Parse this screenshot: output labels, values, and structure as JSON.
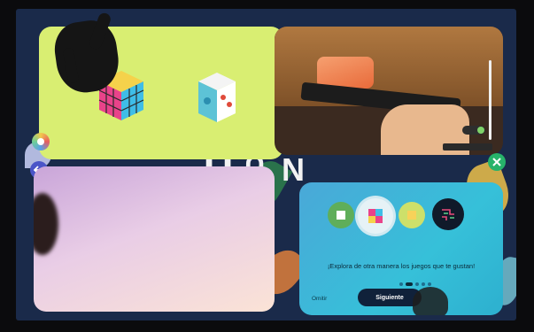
{
  "onboarding": {
    "prompt": "¡Explora de otra manera los juegos que te gustan!",
    "skip_label": "Omitir",
    "next_label": "Siguiente",
    "page_dots": 5,
    "active_dot": 1
  },
  "icons": {
    "back": "back-arrow-icon",
    "close": "close-icon",
    "app": "app-logo-icon",
    "rubiks": "rubiks-cube-icon",
    "dice": "dice-cube-icon",
    "circuit": "circuit-icon"
  },
  "colors": {
    "games_card": "#d9ee72",
    "onboarding_card": "#36c0d9",
    "next_button": "#10213a",
    "close_button": "#27b36a",
    "back_button": "#4a55c8"
  }
}
